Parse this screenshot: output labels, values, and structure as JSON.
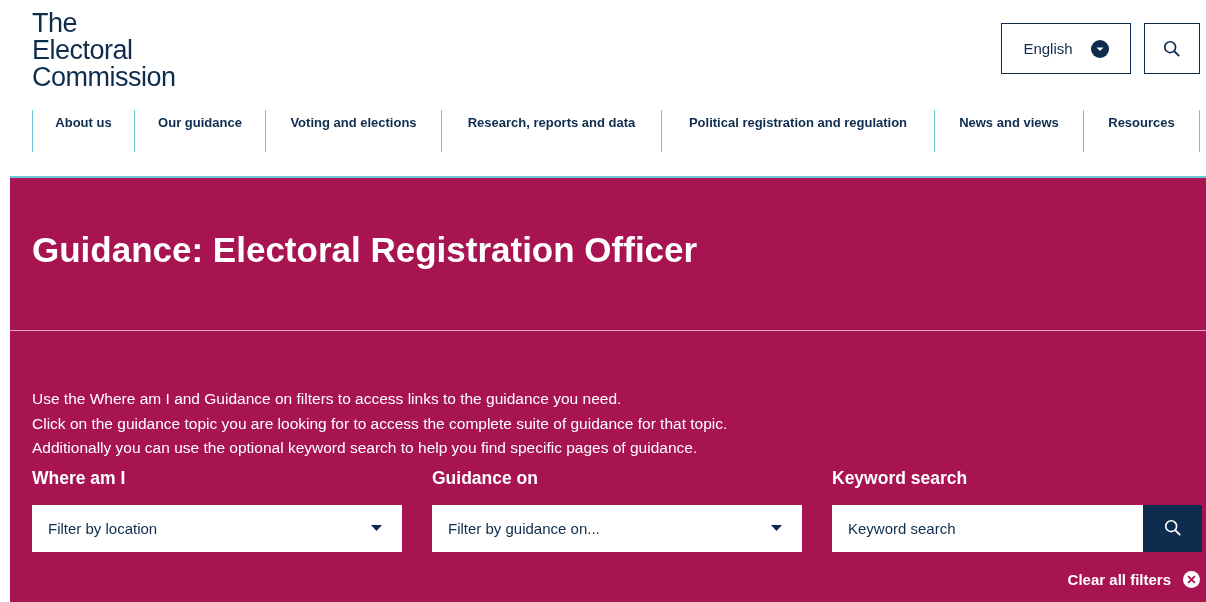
{
  "logo": {
    "lines": [
      "The",
      "Electoral",
      "Commission"
    ]
  },
  "language": {
    "label": "English"
  },
  "nav": [
    {
      "label": "About us"
    },
    {
      "label": "Our guidance"
    },
    {
      "label": "Voting and elections"
    },
    {
      "label": "Research, reports and data"
    },
    {
      "label": "Political registration and regulation"
    },
    {
      "label": "News and views"
    },
    {
      "label": "Resources"
    }
  ],
  "hero": {
    "title": "Guidance: Electoral Registration Officer"
  },
  "intro": [
    "Use the Where am I and Guidance on filters to access links to the guidance you need.",
    "Click on the guidance topic you are looking for to access the complete suite of guidance for that topic.",
    "Additionally you can use the optional keyword search to help you find specific pages of guidance."
  ],
  "filters": [
    {
      "kind": "dropdown",
      "label": "Where am I",
      "placeholder": "Filter by location"
    },
    {
      "kind": "dropdown",
      "label": "Guidance on",
      "placeholder": "Filter by guidance on..."
    },
    {
      "kind": "search",
      "label": "Keyword search",
      "placeholder": "Keyword search"
    }
  ],
  "clear_filters": "Clear all filters"
}
